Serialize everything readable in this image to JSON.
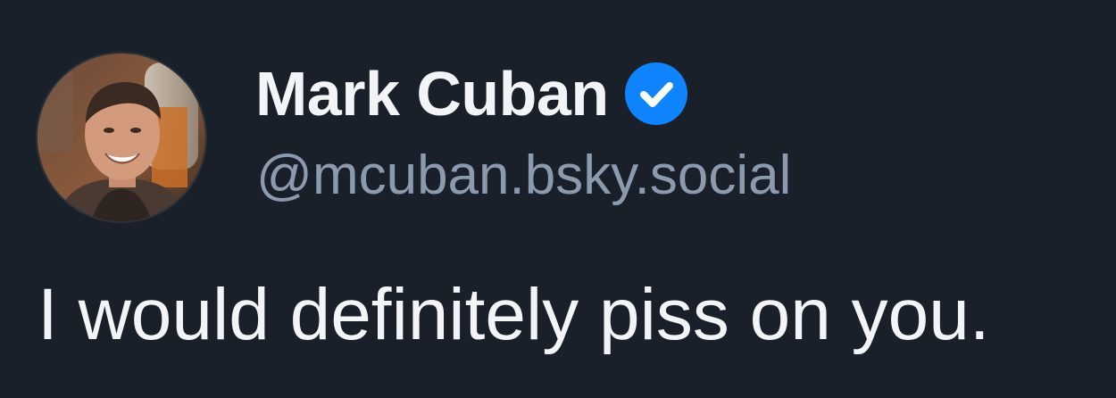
{
  "post": {
    "author": {
      "display_name": "Mark Cuban",
      "handle": "@mcuban.bsky.social",
      "verified": true,
      "avatar_icon": "profile-photo"
    },
    "text": "I would definitely piss on you."
  },
  "colors": {
    "background": "#19202a",
    "primary_text": "#f2f4f7",
    "secondary_text": "#8c9aae",
    "verified_badge": "#1083fe"
  }
}
